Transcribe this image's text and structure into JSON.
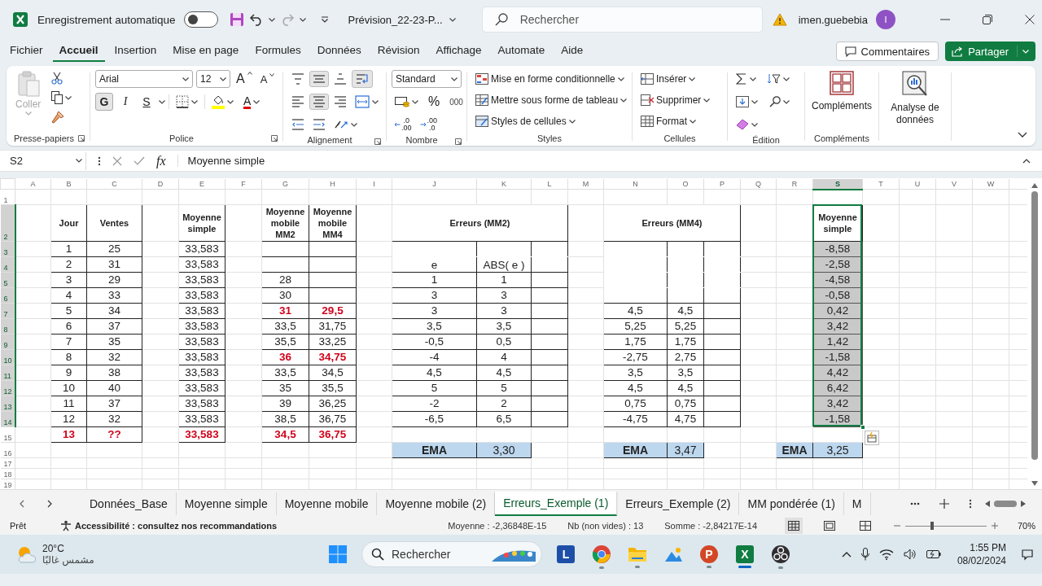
{
  "title_bar": {
    "autosave_label": "Enregistrement automatique",
    "autosave_on": false,
    "filename": "Prévision_22-23-P...",
    "search_placeholder": "Rechercher",
    "user": "imen.guebebia",
    "avatar_initial": "I"
  },
  "menu": {
    "tabs": [
      {
        "label": "Fichier",
        "selected": false
      },
      {
        "label": "Accueil",
        "selected": true
      },
      {
        "label": "Insertion",
        "selected": false
      },
      {
        "label": "Mise en page",
        "selected": false
      },
      {
        "label": "Formules",
        "selected": false
      },
      {
        "label": "Données",
        "selected": false
      },
      {
        "label": "Révision",
        "selected": false
      },
      {
        "label": "Affichage",
        "selected": false
      },
      {
        "label": "Automate",
        "selected": false
      },
      {
        "label": "Aide",
        "selected": false
      }
    ],
    "comments_button": "Commentaires",
    "share_button": "Partager"
  },
  "ribbon": {
    "clipboard": {
      "paste": "Coller",
      "paste_disabled": true,
      "label": "Presse-papiers"
    },
    "font": {
      "name": "Arial",
      "size": "12",
      "grow": "A",
      "shrink": "A",
      "bold_key": "G",
      "bold": true,
      "italic_key": "I",
      "italic": false,
      "underline_key": "S",
      "underline": false,
      "color_key": "A",
      "label": "Police"
    },
    "alignment": {
      "middle": true,
      "center": true,
      "wrap": true,
      "label": "Alignement"
    },
    "number": {
      "format": "Standard",
      "percent": "%",
      "thousands": "000",
      "decimals": [
        {
          "top": ".0",
          "bottom": ".00"
        },
        {
          "top": ".00",
          "bottom": ".0"
        }
      ],
      "label": "Nombre"
    },
    "styles": {
      "items": [
        "Mise en forme conditionnelle",
        "Mettre sous forme de tableau",
        "Styles de cellules"
      ],
      "label": "Styles"
    },
    "cells": {
      "items": [
        "Insérer",
        "Supprimer",
        "Format"
      ],
      "label": "Cellules"
    },
    "editing": {
      "label": "Édition"
    },
    "addins": {
      "button": "Compléments",
      "label": "Compléments"
    },
    "analysis": {
      "button": "Analyse de données"
    }
  },
  "formula_bar": {
    "name_box": "S2",
    "fx": "fx",
    "formula": "Moyenne simple"
  },
  "sheet": {
    "columns": [
      {
        "label": "A",
        "selected": false
      },
      {
        "label": "B",
        "selected": false
      },
      {
        "label": "C",
        "selected": false
      },
      {
        "label": "D",
        "selected": false
      },
      {
        "label": "E",
        "selected": false
      },
      {
        "label": "F",
        "selected": false
      },
      {
        "label": "G",
        "selected": false
      },
      {
        "label": "H",
        "selected": false
      },
      {
        "label": "I",
        "selected": false
      },
      {
        "label": "J",
        "selected": false
      },
      {
        "label": "K",
        "selected": false
      },
      {
        "label": "L",
        "selected": false
      },
      {
        "label": "M",
        "selected": false
      },
      {
        "label": "N",
        "selected": false
      },
      {
        "label": "O",
        "selected": false
      },
      {
        "label": "P",
        "selected": false
      },
      {
        "label": "Q",
        "selected": false
      },
      {
        "label": "R",
        "selected": false
      },
      {
        "label": "S",
        "selected": true
      },
      {
        "label": "T",
        "selected": false
      },
      {
        "label": "U",
        "selected": false
      },
      {
        "label": "V",
        "selected": false
      },
      {
        "label": "W",
        "selected": false
      }
    ],
    "rows": [
      {
        "label": "1",
        "selected": false
      },
      {
        "label": "2",
        "selected": true
      },
      {
        "label": "3",
        "selected": true
      },
      {
        "label": "4",
        "selected": true
      },
      {
        "label": "5",
        "selected": true
      },
      {
        "label": "6",
        "selected": true
      },
      {
        "label": "7",
        "selected": true
      },
      {
        "label": "8",
        "selected": true
      },
      {
        "label": "9",
        "selected": true
      },
      {
        "label": "10",
        "selected": true
      },
      {
        "label": "11",
        "selected": true
      },
      {
        "label": "12",
        "selected": true
      },
      {
        "label": "13",
        "selected": true
      },
      {
        "label": "14",
        "selected": true
      },
      {
        "label": "15",
        "selected": false
      },
      {
        "label": "16",
        "selected": false
      },
      {
        "label": "17",
        "selected": false
      },
      {
        "label": "18",
        "selected": false
      },
      {
        "label": "19",
        "selected": false
      }
    ],
    "blocks": [
      {
        "rows": [
          {
            "kind": "header",
            "cells": [
              "Jour",
              "Ventes"
            ]
          },
          {
            "kind": "value",
            "cells": [
              "1",
              "25"
            ]
          },
          {
            "kind": "value",
            "cells": [
              "2",
              "31"
            ]
          },
          {
            "kind": "value",
            "cells": [
              "3",
              "29"
            ]
          },
          {
            "kind": "value",
            "cells": [
              "4",
              "33"
            ]
          },
          {
            "kind": "value",
            "cells": [
              "5",
              "34"
            ]
          },
          {
            "kind": "value",
            "cells": [
              "6",
              "37"
            ]
          },
          {
            "kind": "value",
            "cells": [
              "7",
              "35"
            ]
          },
          {
            "kind": "value",
            "cells": [
              "8",
              "32"
            ]
          },
          {
            "kind": "value",
            "cells": [
              "9",
              "38"
            ]
          },
          {
            "kind": "value",
            "cells": [
              "10",
              "40"
            ]
          },
          {
            "kind": "value",
            "cells": [
              "11",
              "37"
            ]
          },
          {
            "kind": "value",
            "cells": [
              "12",
              "32"
            ]
          },
          {
            "kind": "highlight",
            "cells": [
              "13",
              "??"
            ]
          }
        ]
      },
      {
        "rows": [
          {
            "kind": "header",
            "cells": [
              "Moyenne simple"
            ]
          },
          {
            "kind": "value",
            "cells": [
              "33,583"
            ]
          },
          {
            "kind": "value",
            "cells": [
              "33,583"
            ]
          },
          {
            "kind": "value",
            "cells": [
              "33,583"
            ]
          },
          {
            "kind": "value",
            "cells": [
              "33,583"
            ]
          },
          {
            "kind": "value",
            "cells": [
              "33,583"
            ]
          },
          {
            "kind": "value",
            "cells": [
              "33,583"
            ]
          },
          {
            "kind": "value",
            "cells": [
              "33,583"
            ]
          },
          {
            "kind": "value",
            "cells": [
              "33,583"
            ]
          },
          {
            "kind": "value",
            "cells": [
              "33,583"
            ]
          },
          {
            "kind": "value",
            "cells": [
              "33,583"
            ]
          },
          {
            "kind": "value",
            "cells": [
              "33,583"
            ]
          },
          {
            "kind": "value",
            "cells": [
              "33,583"
            ]
          },
          {
            "kind": "highlight",
            "cells": [
              "33,583"
            ]
          }
        ]
      },
      {
        "rows": [
          {
            "kind": "header",
            "cells": [
              "Moyenne mobile MM2",
              "Moyenne mobile MM4"
            ]
          },
          {
            "kind": "blank",
            "cells": []
          },
          {
            "kind": "blank",
            "cells": []
          },
          {
            "kind": "value",
            "cells": [
              "28"
            ]
          },
          {
            "kind": "value",
            "cells": [
              "30"
            ]
          },
          {
            "kind": "highlight",
            "cells": [
              "31",
              "29,5"
            ]
          },
          {
            "kind": "value",
            "cells": [
              "33,5",
              "31,75"
            ]
          },
          {
            "kind": "value",
            "cells": [
              "35,5",
              "33,25"
            ]
          },
          {
            "kind": "highlight",
            "cells": [
              "36",
              "34,75"
            ]
          },
          {
            "kind": "value",
            "cells": [
              "33,5",
              "34,5"
            ]
          },
          {
            "kind": "value",
            "cells": [
              "35",
              "35,5"
            ]
          },
          {
            "kind": "value",
            "cells": [
              "39",
              "36,25"
            ]
          },
          {
            "kind": "value",
            "cells": [
              "38,5",
              "36,75"
            ]
          },
          {
            "kind": "highlight",
            "cells": [
              "34,5",
              "36,75"
            ]
          }
        ]
      },
      {
        "title": "Erreurs (MM2)",
        "rows": [
          {
            "kind": "spacer",
            "cells": []
          },
          {
            "kind": "value",
            "cells": [
              "e",
              "ABS( e )"
            ]
          },
          {
            "kind": "value",
            "cells": [
              "1",
              "1"
            ]
          },
          {
            "kind": "value",
            "cells": [
              "3",
              "3"
            ]
          },
          {
            "kind": "value",
            "cells": [
              "3",
              "3"
            ]
          },
          {
            "kind": "value",
            "cells": [
              "3,5",
              "3,5"
            ]
          },
          {
            "kind": "value",
            "cells": [
              "-0,5",
              "0,5"
            ]
          },
          {
            "kind": "value",
            "cells": [
              "-4",
              "4"
            ]
          },
          {
            "kind": "value",
            "cells": [
              "4,5",
              "4,5"
            ]
          },
          {
            "kind": "value",
            "cells": [
              "5",
              "5"
            ]
          },
          {
            "kind": "value",
            "cells": [
              "-2",
              "2"
            ]
          },
          {
            "kind": "value",
            "cells": [
              "-6,5",
              "6,5"
            ]
          }
        ]
      },
      {
        "title": "Erreurs (MM4)",
        "rows": [
          {
            "kind": "spacer",
            "cells": []
          },
          {
            "kind": "spacer",
            "cells": []
          },
          {
            "kind": "spacer",
            "cells": []
          },
          {
            "kind": "blank",
            "cells": []
          },
          {
            "kind": "value",
            "cells": [
              "4,5",
              "4,5"
            ]
          },
          {
            "kind": "value",
            "cells": [
              "5,25",
              "5,25"
            ]
          },
          {
            "kind": "value",
            "cells": [
              "1,75",
              "1,75"
            ]
          },
          {
            "kind": "value",
            "cells": [
              "-2,75",
              "2,75"
            ]
          },
          {
            "kind": "value",
            "cells": [
              "3,5",
              "3,5"
            ]
          },
          {
            "kind": "value",
            "cells": [
              "4,5",
              "4,5"
            ]
          },
          {
            "kind": "value",
            "cells": [
              "0,75",
              "0,75"
            ]
          },
          {
            "kind": "value",
            "cells": [
              "-4,75",
              "4,75"
            ]
          }
        ]
      },
      {
        "selected": true,
        "rows": [
          {
            "kind": "header",
            "cells": [
              "Moyenne simple"
            ]
          },
          {
            "kind": "shaded",
            "cells": [
              "-8,58"
            ]
          },
          {
            "kind": "shaded",
            "cells": [
              "-2,58"
            ]
          },
          {
            "kind": "shaded",
            "cells": [
              "-4,58"
            ]
          },
          {
            "kind": "shaded",
            "cells": [
              "-0,58"
            ]
          },
          {
            "kind": "shaded",
            "cells": [
              "0,42"
            ]
          },
          {
            "kind": "shaded",
            "cells": [
              "3,42"
            ]
          },
          {
            "kind": "shaded",
            "cells": [
              "1,42"
            ]
          },
          {
            "kind": "shaded",
            "cells": [
              "-1,58"
            ]
          },
          {
            "kind": "shaded",
            "cells": [
              "4,42"
            ]
          },
          {
            "kind": "shaded",
            "cells": [
              "6,42"
            ]
          },
          {
            "kind": "shaded",
            "cells": [
              "3,42"
            ]
          },
          {
            "kind": "shaded",
            "cells": [
              "-1,58"
            ]
          }
        ]
      },
      {
        "rows": [
          {
            "kind": "ema",
            "cells": [
              "EMA",
              "3,30"
            ]
          }
        ]
      },
      {
        "rows": [
          {
            "kind": "ema",
            "cells": [
              "EMA",
              "3,47"
            ]
          }
        ]
      },
      {
        "rows": [
          {
            "kind": "ema",
            "cells": [
              "EMA",
              "3,25"
            ]
          }
        ]
      }
    ]
  },
  "sheet_tabs": [
    {
      "label": "Données_Base",
      "selected": false
    },
    {
      "label": "Moyenne simple",
      "selected": false
    },
    {
      "label": "Moyenne mobile",
      "selected": false
    },
    {
      "label": "Moyenne mobile (2)",
      "selected": false
    },
    {
      "label": "Erreurs_Exemple (1)",
      "selected": true
    },
    {
      "label": "Erreurs_Exemple (2)",
      "selected": false
    },
    {
      "label": "MM pondérée (1)",
      "selected": false
    },
    {
      "label": "M",
      "selected": false
    }
  ],
  "status_bar": {
    "mode": "Prêt",
    "accessibility": "Accessibilité : consultez nos recommandations",
    "stats": [
      "Moyenne : -2,36848E-15",
      "Nb (non vides) : 13",
      "Somme : -2,84217E-14"
    ],
    "zoom": {
      "level": 0.33,
      "reading": "70%"
    }
  },
  "taskbar": {
    "temperature": "20°C",
    "weather": "مشمس غالبًا",
    "search_placeholder": "Rechercher",
    "apps": [
      {
        "kind": "start",
        "running": false
      },
      {
        "kind": "tile",
        "label": "L",
        "running": false
      },
      {
        "kind": "chrome",
        "running": true
      },
      {
        "kind": "folder",
        "running": true
      },
      {
        "kind": "photos",
        "running": false
      },
      {
        "kind": "powerpoint",
        "label": "P",
        "running": true
      },
      {
        "kind": "excel",
        "label": "X",
        "running": true
      },
      {
        "kind": "obs",
        "running": true
      }
    ],
    "time": "1:55 PM",
    "date": "08/02/2024"
  }
}
